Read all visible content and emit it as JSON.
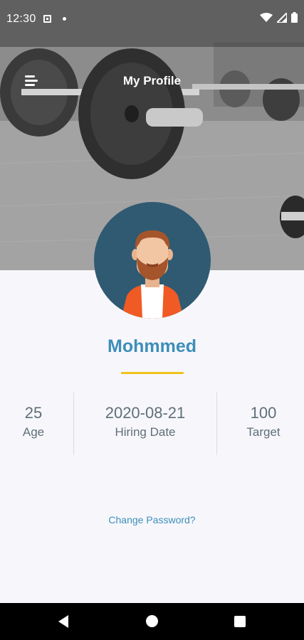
{
  "status_bar": {
    "time": "12:30",
    "icons": [
      "image-notification-icon",
      "dot-icon",
      "wifi-icon",
      "signal-icon",
      "battery-icon"
    ]
  },
  "app_bar": {
    "title": "My Profile",
    "menu_icon": "hamburger-menu-icon"
  },
  "profile": {
    "name": "Mohmmed",
    "stats": [
      {
        "value": "25",
        "label": "Age"
      },
      {
        "value": "2020-08-21",
        "label": "Hiring Date"
      },
      {
        "value": "100",
        "label": "Target"
      }
    ],
    "change_password": "Change Password?"
  },
  "colors": {
    "accent": "#3d8eb9",
    "underline": "#f2c21b",
    "avatar_bg": "#2f5a72",
    "stat_text": "#5f6f78"
  },
  "nav_bar": {
    "icons": [
      "back-icon",
      "home-icon",
      "recent-apps-icon"
    ]
  }
}
